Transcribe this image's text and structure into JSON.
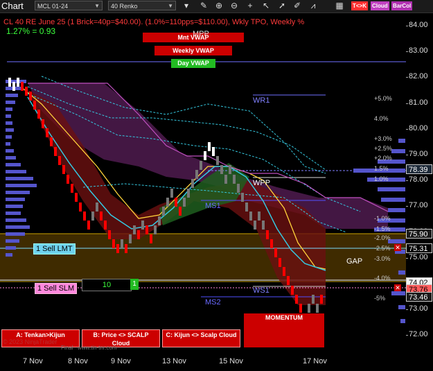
{
  "toolbar": {
    "title": "Chart",
    "instrument": "MCL 01-24",
    "bar_type": "40 Renko",
    "buttons": [
      "T<>K",
      "Cloud",
      "BarCol"
    ],
    "icons": [
      "dropdown-icon",
      "crosshair-icon",
      "pencil-icon",
      "zoom-in-icon",
      "zoom-out-icon",
      "crosshair-plus-icon",
      "pointer-icon",
      "cursor-icon",
      "pencil-icon",
      "line-chart-icon",
      "grid-icon"
    ]
  },
  "chart": {
    "header_line": "CL 40 RE June 25 (1 Brick=40p=$40.00). (1.0%=110pps=$110.00), Wkly TPO, Weekly %",
    "ratio_line": "1.27% = 0.93",
    "vwap_labels": [
      "Mnt VWAP",
      "Weekly VWAP",
      "Day VWAP"
    ],
    "vwap_over_label": "MPP",
    "pivot_labels": {
      "wr1": "WR1",
      "wpp": "WPP",
      "ms1": "MS1",
      "ws1": "WS1",
      "ms2": "MS2",
      "gap": "GAP"
    },
    "percent_labels_right": [
      "+5.0%",
      "4.0%",
      "+3.0%",
      "+2.5%",
      "+2.0%",
      "1.5%",
      "1.0%",
      "-1.0%",
      "-1.5%",
      "-2.0%",
      "-2.5%",
      "-3.0%",
      "-4.0%",
      "-5%"
    ],
    "y_ticks": [
      "84.00",
      "83.00",
      "82.00",
      "81.00",
      "80.00",
      "79.00",
      "78.00",
      "77.00",
      "76.00",
      "75.00",
      "74.00",
      "73.00",
      "72.00"
    ],
    "x_ticks": [
      "7 Nov",
      "8 Nov",
      "9 Nov",
      "13 Nov",
      "15 Nov",
      "17 Nov"
    ],
    "price_tags": [
      {
        "value": "78.39",
        "bg": "#1e2a38",
        "fg": "#ffffff"
      },
      {
        "value": "75.90",
        "bg": "#1a1a1a",
        "fg": "#ffffff"
      },
      {
        "value": "75.31",
        "bg": "#000000",
        "fg": "#ffffff"
      },
      {
        "value": "74.02",
        "bg": "#f2f2f2",
        "fg": "#000000"
      },
      {
        "value": "73.76",
        "bg": "#ff5c5c",
        "fg": "#000000"
      },
      {
        "value": "73.46",
        "bg": "#1a1a1a",
        "fg": "#ffffff"
      }
    ],
    "orders": {
      "sell_lmt": "1 Sell LMT",
      "sell_slm": "1 Sell SLM",
      "quantity": "10",
      "qty_badge": "1"
    },
    "momentum": "MOMENTUM",
    "watermark": "© 2023 NinjaTrader",
    "watermark2": "Final",
    "watermark3": "www.tin-tnr.com"
  },
  "bottom_buttons": [
    {
      "label_1": "A: Tenkan>Kijun",
      "label_2": ""
    },
    {
      "label_1": "B: Price <> SCALP",
      "label_2": "Cloud"
    },
    {
      "label_1": "C: Kijun <> Scalp Cloud",
      "label_2": ""
    }
  ],
  "colors": {
    "up_brick": "#ffffff",
    "down_brick": "#ff0000",
    "neutral_brick": "#777777",
    "accent_red": "#cc0000",
    "vwap_green": "#22bb22",
    "purple_cloud": "#7a2a7a",
    "red_cloud": "#7a1010",
    "green_cloud": "#1e5e1e"
  }
}
